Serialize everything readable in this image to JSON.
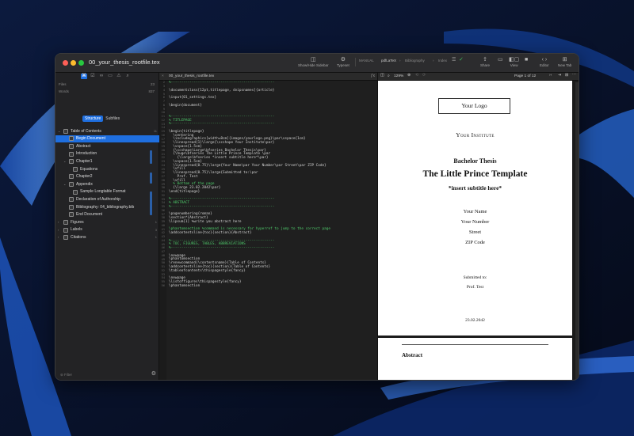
{
  "window": {
    "title": "00_your_thesis_rootfile.tex"
  },
  "toolbar": {
    "sidebar_label": "Show/Hide Sidebar",
    "typeset_label": "Typeset",
    "mode": "MANUAL",
    "engine": "pdfLaTeX",
    "crumb1": "Bibliography",
    "crumb2": "Index",
    "share_label": "Share",
    "view_label": "View",
    "editor_label": "Editor",
    "newtab_label": "New Tab"
  },
  "sidebar": {
    "stats": [
      {
        "label": "Files",
        "value": "23"
      },
      {
        "label": "Words",
        "value": "837"
      }
    ],
    "tabs": {
      "structure": "Structure",
      "subfiles": "Subfiles"
    },
    "tree": [
      {
        "label": "Table of Contents",
        "count": "11",
        "indent": 0,
        "chev": "v"
      },
      {
        "label": "Begin Document",
        "indent": 1,
        "sel": true
      },
      {
        "label": "Abstract",
        "indent": 1
      },
      {
        "label": "Introduction",
        "indent": 1
      },
      {
        "label": "Chapter1",
        "indent": 1,
        "chev": "v"
      },
      {
        "label": "Equations",
        "indent": 2
      },
      {
        "label": "Chapter2",
        "indent": 1
      },
      {
        "label": "Appendix",
        "indent": 1,
        "chev": "v"
      },
      {
        "label": "Sample Longtable Format",
        "indent": 2
      },
      {
        "label": "Declaration of Authorship",
        "indent": 1
      },
      {
        "label": "Bibliography: 04_bibliography.bib",
        "indent": 1
      },
      {
        "label": "End Document",
        "indent": 1
      },
      {
        "label": "Figures",
        "count": "1",
        "indent": 0,
        "chev": ">"
      },
      {
        "label": "Labels",
        "count": "3",
        "indent": 0,
        "chev": ">"
      },
      {
        "label": "Citations",
        "count": "1",
        "indent": 0,
        "chev": ">"
      }
    ],
    "filter_placeholder": "Filter"
  },
  "editor": {
    "tab": "00_your_thesis_rootfile.tex",
    "lines": [
      {
        "n": "2",
        "t": "%--------------------------------------------------",
        "k": "cm"
      },
      {
        "n": "3",
        "t": ""
      },
      {
        "n": "4",
        "t": "\\documentclass[12pt,titlepage, dvipsnames]{article}"
      },
      {
        "n": "5",
        "t": ""
      },
      {
        "n": "6",
        "t": "\\input{01_settings.tex}"
      },
      {
        "n": "7",
        "t": ""
      },
      {
        "n": "8",
        "t": "\\begin{document}"
      },
      {
        "n": "9",
        "t": ""
      },
      {
        "n": "10",
        "t": ""
      },
      {
        "n": "11",
        "t": "%--------------------------------------------------",
        "k": "cm"
      },
      {
        "n": "12",
        "t": "% TITLEPAGE",
        "k": "cm"
      },
      {
        "n": "13",
        "t": "%--------------------------------------------------",
        "k": "cm"
      },
      {
        "n": "14",
        "t": ""
      },
      {
        "n": "15",
        "t": "\\begin{titlepage}"
      },
      {
        "n": "16",
        "t": "  \\centering"
      },
      {
        "n": "17",
        "t": "  \\includegraphics[width=8cm]{images/yourlogo.png}\\par\\vspace{1cm}"
      },
      {
        "n": "18",
        "t": "  \\linespread{1}\\large{\\scshape Your Institute\\par}"
      },
      {
        "n": "19",
        "t": "  \\vspace{1.5cm}"
      },
      {
        "n": "20",
        "t": "  {\\scshape\\Large\\bfseries Bachelor Thesis\\par}"
      },
      {
        "n": "21",
        "t": "  {\\huge\\bfseries The Little Prince Template \\par"
      },
      {
        "n": "22",
        "t": "    {\\large\\bfseries *insert subtitle here*\\par}"
      },
      {
        "n": "23",
        "t": "  \\vspace{1.5cm}"
      },
      {
        "n": "24",
        "t": "  \\linespread{0.75}\\large{Your Name\\par Your Number\\par Street\\par ZIP Code}"
      },
      {
        "n": "25",
        "t": "  \\vfill"
      },
      {
        "n": "26",
        "t": "  \\linespread{0.75}\\large{Submitted to:\\par"
      },
      {
        "n": "27",
        "t": "    Prof. Test"
      },
      {
        "n": "28",
        "t": "  \\vfill"
      },
      {
        "n": "29",
        "t": "  % Bottom of the page",
        "k": "cm"
      },
      {
        "n": "30",
        "t": "  {\\large 23.02.2042\\par}"
      },
      {
        "n": "31",
        "t": "\\end{titlepage}"
      },
      {
        "n": "32",
        "t": ""
      },
      {
        "n": "33",
        "t": "%--------------------------------------------------",
        "k": "cm"
      },
      {
        "n": "34",
        "t": "% ABSTRACT",
        "k": "cm"
      },
      {
        "n": "35",
        "t": "%--------------------------------------------------",
        "k": "cm"
      },
      {
        "n": "36",
        "t": ""
      },
      {
        "n": "37",
        "t": "\\pagenumbering{roman}"
      },
      {
        "n": "38",
        "t": "\\section*{Abstract}"
      },
      {
        "n": "39",
        "t": "\\lipsum[1] %write you abstract here"
      },
      {
        "n": "40",
        "t": ""
      },
      {
        "n": "41",
        "t": "\\phantomsection %command is necessary for hyperref to jump to the correct page",
        "k": "cm"
      },
      {
        "n": "42",
        "t": "\\addcontentsline{toc}{section}{Abstract}"
      },
      {
        "n": "43",
        "t": ""
      },
      {
        "n": "44",
        "t": "%--------------------------------------------------",
        "k": "cm"
      },
      {
        "n": "45",
        "t": "% TOC, FIGURES, TABLES, ABBREVIATIONS",
        "k": "cm"
      },
      {
        "n": "46",
        "t": "%--------------------------------------------------",
        "k": "cm"
      },
      {
        "n": "47",
        "t": ""
      },
      {
        "n": "48",
        "t": "\\newpage"
      },
      {
        "n": "49",
        "t": "\\phantomsection"
      },
      {
        "n": "50",
        "t": "\\renewcommand{\\contentsname}{Table of Contents}"
      },
      {
        "n": "51",
        "t": "\\addcontentsline{toc}{section}{Table of Contents}"
      },
      {
        "n": "52",
        "t": "\\tableofcontents\\thispagestyle{fancy}"
      },
      {
        "n": "53",
        "t": ""
      },
      {
        "n": "54",
        "t": "\\newpage"
      },
      {
        "n": "55",
        "t": "\\listoffigures\\thispagestyle{fancy}"
      },
      {
        "n": "56",
        "t": "\\phantomsection"
      }
    ]
  },
  "pdf": {
    "zoom": "129%",
    "page_indicator": "Page 1 of 12",
    "logo": "Your Logo",
    "institute": "Your Institute",
    "thesis": "Bachelor Thesis",
    "title": "The Little Prince Template",
    "subtitle": "*insert subtitle here*",
    "name": "Your Name",
    "number": "Your Number",
    "street": "Street",
    "zip": "ZIP Code",
    "submitted": "Submitted to:",
    "prof": "Prof. Test",
    "date": "23.02.2042",
    "abstract": "Abstract"
  }
}
